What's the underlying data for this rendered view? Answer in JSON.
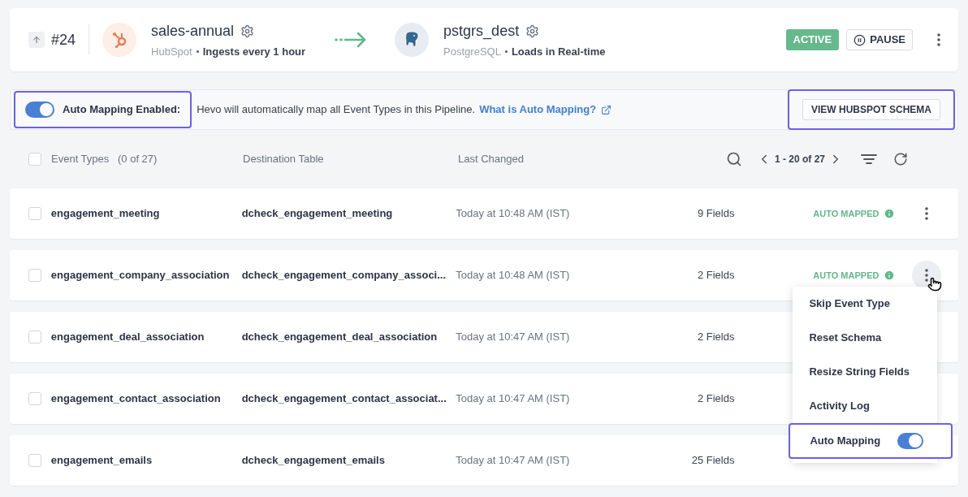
{
  "pipeline": {
    "number": "#24",
    "source": {
      "name": "sales-annual",
      "type": "HubSpot",
      "schedule": "Ingests every 1 hour"
    },
    "destination": {
      "name": "pstgrs_dest",
      "type": "PostgreSQL",
      "schedule": "Loads in Real-time"
    },
    "status": "ACTIVE",
    "pause_button": "PAUSE"
  },
  "banner": {
    "auto_mapping_on": true,
    "highlighted": true,
    "label": "Auto Mapping Enabled:",
    "text": "Hevo will automatically map all Event Types in this Pipeline.",
    "link": "What is Auto Mapping?",
    "button": "VIEW HUBSPOT SCHEMA",
    "button_highlighted": true
  },
  "table": {
    "select_all_checked": false,
    "columns": [
      "Event Types",
      "Destination Table",
      "Last Changed"
    ],
    "count": "(0 of 27)",
    "pagination": "1 - 20 of 27",
    "rows": [
      {
        "name": "engagement_meeting",
        "table": "dcheck_engagement_meeting",
        "changed": "Today at 10:48 AM (IST)",
        "fields": "9 Fields",
        "status": "AUTO MAPPED",
        "checked": false,
        "menu_open": false
      },
      {
        "name": "engagement_company_association",
        "table": "dcheck_engagement_company_associ...",
        "changed": "Today at 10:48 AM (IST)",
        "fields": "2 Fields",
        "status": "AUTO MAPPED",
        "checked": false,
        "menu_open": true
      },
      {
        "name": "engagement_deal_association",
        "table": "dcheck_engagement_deal_association",
        "changed": "Today at 10:47 AM (IST)",
        "fields": "2 Fields",
        "checked": false,
        "menu_open": false
      },
      {
        "name": "engagement_contact_association",
        "table": "dcheck_engagement_contact_associat...",
        "changed": "Today at 10:47 AM (IST)",
        "fields": "2 Fields",
        "checked": false,
        "menu_open": false
      },
      {
        "name": "engagement_emails",
        "table": "dcheck_engagement_emails",
        "changed": "Today at 10:47 AM (IST)",
        "fields": "25 Fields",
        "checked": false,
        "menu_open": false
      }
    ]
  },
  "menu": {
    "items": [
      {
        "kind": "action",
        "label": "Skip Event Type"
      },
      {
        "kind": "action",
        "label": "Reset Schema"
      },
      {
        "kind": "action",
        "label": "Resize String Fields"
      },
      {
        "kind": "action",
        "label": "Activity Log"
      },
      {
        "kind": "toggle",
        "label": "Auto Mapping",
        "on": true,
        "highlighted": true
      }
    ]
  }
}
